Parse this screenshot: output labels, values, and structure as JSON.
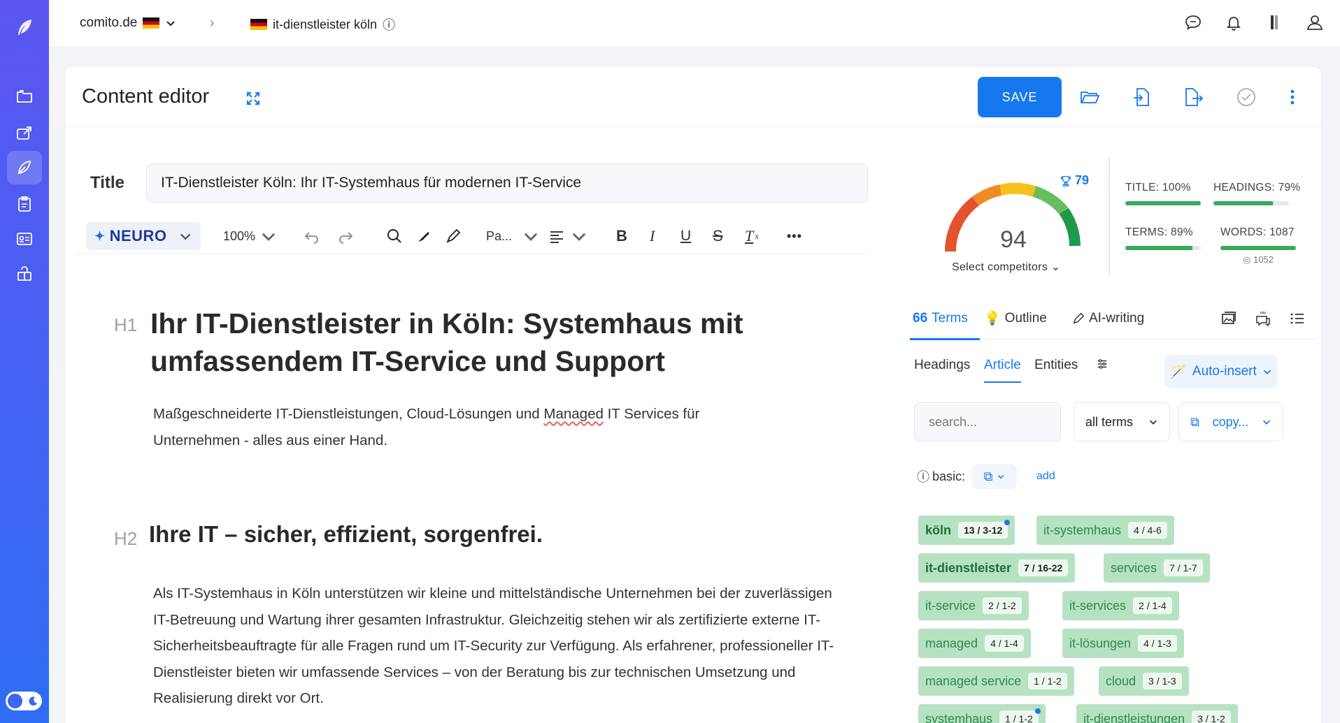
{
  "sidebar": {
    "items": [
      {
        "icon": "folder-icon"
      },
      {
        "icon": "share-icon"
      },
      {
        "icon": "feather-icon"
      },
      {
        "icon": "clipboard-icon"
      },
      {
        "icon": "id-card-icon"
      },
      {
        "icon": "box-icon"
      }
    ]
  },
  "topbar": {
    "domain": "comito.de",
    "separator": "›",
    "project": "it-dienstleister köln",
    "info": "ⓘ"
  },
  "header": {
    "title": "Content editor",
    "save_label": "SAVE"
  },
  "editor": {
    "title_label": "Title",
    "title_value": "IT-Dienstleister Köln: Ihr IT-Systemhaus für modernen IT-Service",
    "toolbar": {
      "neuro_label": "NEURO",
      "zoom": "100%",
      "paragraph": "Pa...",
      "more": "•••"
    },
    "h1_tag": "H1",
    "h1": "Ihr IT-Dienstleister in Köln: Systemhaus mit umfassendem IT-Service und Support",
    "p1_before": "Maßgeschneiderte IT-Dienstleistungen, Cloud-Lösungen und ",
    "p1_underlined": "Managed",
    "p1_after": " IT Services für Unternehmen - alles aus einer Hand.",
    "h2_tag": "H2",
    "h2": "Ihre IT – sicher, effizient, sorgenfrei.",
    "p2": "Als IT-Systemhaus in Köln unterstützen wir kleine und mittelständische Unternehmen bei der zuverlässigen IT-Betreuung und Wartung ihrer gesamten Infrastruktur. Gleichzeitig stehen wir als zertifizierte externe IT-Sicherheitsbeauftragte für alle Fragen rund um IT-Security zur Verfügung. Als erfahrener, professioneller IT-Dienstleister bieten wir umfassende Services – von der Beratung bis zur technischen Umsetzung und Realisierung direkt vor Ort."
  },
  "score": {
    "value": "94",
    "top_score": "79",
    "select_label": "Select competitors ⌄",
    "metrics": [
      {
        "label": "TITLE: 100%",
        "fill": 1.0
      },
      {
        "label": "HEADINGS: 79%",
        "fill": 0.79
      },
      {
        "label": "TERMS: 89%",
        "fill": 0.89
      },
      {
        "label": "WORDS: 1087",
        "fill": 1.0,
        "sub": "1052"
      }
    ]
  },
  "tabs": {
    "terms": "Terms",
    "outline": "Outline",
    "ai_writing": "AI-writing"
  },
  "subtabs": {
    "headings": "Headings",
    "article": "Article",
    "entities": "Entities",
    "auto_insert": "Auto-insert"
  },
  "filters": {
    "search_placeholder": "search...",
    "terms_select": "all terms",
    "copy_label": "copy..."
  },
  "basic": {
    "label": "basic:",
    "add": "add"
  },
  "terms": [
    {
      "name": "köln",
      "count": "13 / 3-12",
      "strong": true,
      "dot": true
    },
    {
      "name": "it-systemhaus",
      "count": "4 / 4-6"
    },
    {
      "name": "it-dienstleister",
      "count": "7 / 16-22",
      "strong": true
    },
    {
      "name": "services",
      "count": "7 / 1-7"
    },
    {
      "name": "it-service",
      "count": "2 / 1-2"
    },
    {
      "name": "it-services",
      "count": "2 / 1-4"
    },
    {
      "name": "managed",
      "count": "4 / 1-4"
    },
    {
      "name": "it-lösungen",
      "count": "4 / 1-3"
    },
    {
      "name": "managed service",
      "count": "1 / 1-2"
    },
    {
      "name": "cloud",
      "count": "3 / 1-3"
    },
    {
      "name": "systemhaus",
      "count": "1 / 1-2",
      "dot": true
    },
    {
      "name": "it-dienstleistungen",
      "count": "3 / 1-2"
    }
  ],
  "colors": {
    "accent": "#1678ee",
    "sidebar_top": "#5b55f0",
    "sidebar_bottom": "#2e6df3",
    "term_bg": "#b6e2c2",
    "term_text": "#2e8a4c"
  }
}
